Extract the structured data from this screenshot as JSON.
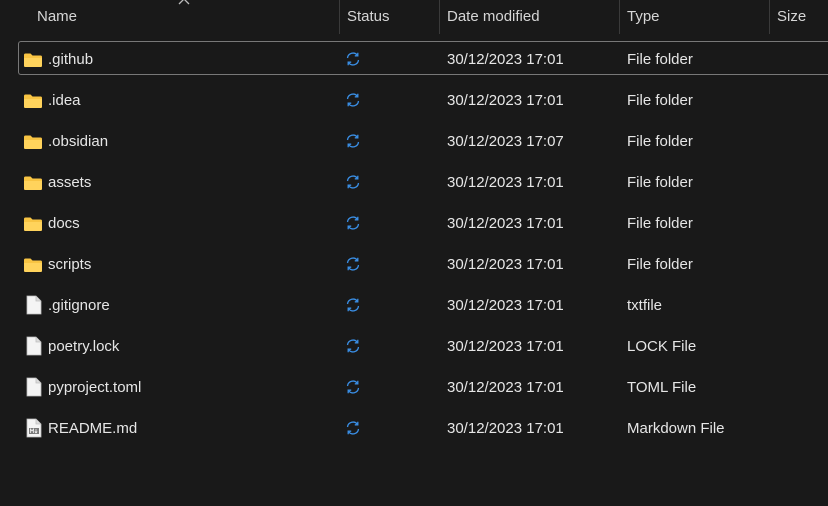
{
  "columns": {
    "name": "Name",
    "status": "Status",
    "date_modified": "Date modified",
    "type": "Type",
    "size": "Size"
  },
  "sort_icon": "chevron-up-icon",
  "status_icon": "sync-icon",
  "files": [
    {
      "name": ".github",
      "date": "30/12/2023 17:01",
      "type": "File folder",
      "icon": "folder-icon",
      "selected": true
    },
    {
      "name": ".idea",
      "date": "30/12/2023 17:01",
      "type": "File folder",
      "icon": "folder-icon"
    },
    {
      "name": ".obsidian",
      "date": "30/12/2023 17:07",
      "type": "File folder",
      "icon": "folder-icon"
    },
    {
      "name": "assets",
      "date": "30/12/2023 17:01",
      "type": "File folder",
      "icon": "folder-icon"
    },
    {
      "name": "docs",
      "date": "30/12/2023 17:01",
      "type": "File folder",
      "icon": "folder-icon"
    },
    {
      "name": "scripts",
      "date": "30/12/2023 17:01",
      "type": "File folder",
      "icon": "folder-icon"
    },
    {
      "name": ".gitignore",
      "date": "30/12/2023 17:01",
      "type": "txtfile",
      "icon": "file-icon"
    },
    {
      "name": "poetry.lock",
      "date": "30/12/2023 17:01",
      "type": "LOCK File",
      "icon": "file-icon"
    },
    {
      "name": "pyproject.toml",
      "date": "30/12/2023 17:01",
      "type": "TOML File",
      "icon": "file-icon"
    },
    {
      "name": "README.md",
      "date": "30/12/2023 17:01",
      "type": "Markdown File",
      "icon": "markdown-file-icon"
    }
  ],
  "colors": {
    "background": "#191919",
    "folder": "#f8c443",
    "sync": "#3a8fe6"
  }
}
